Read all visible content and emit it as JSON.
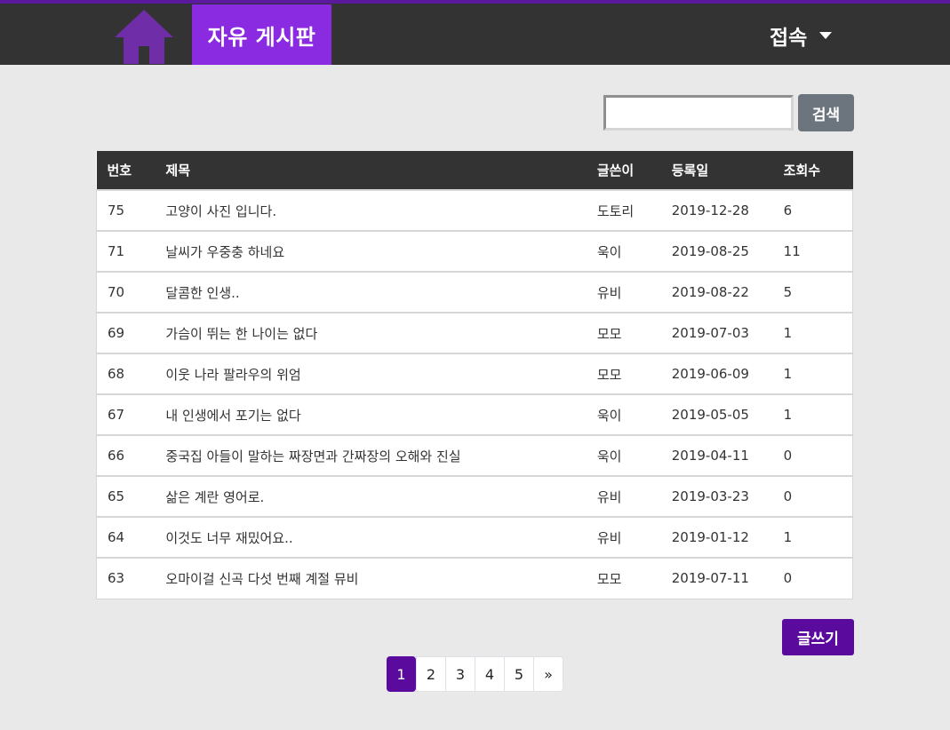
{
  "colors": {
    "header_bg": "#333333",
    "brand_bg": "#8a2be2",
    "home_icon": "#6f2da8",
    "accent_purple": "#5b0a9e",
    "search_button": "#6c757d",
    "page_bg": "#e9e9e9"
  },
  "header": {
    "home_icon": "house-icon",
    "brand": "자유 게시판",
    "connect_menu": "접속",
    "connect_icon": "caret-down-icon"
  },
  "search": {
    "value": "",
    "button_label": "검색"
  },
  "table": {
    "columns": [
      "번호",
      "제목",
      "글쓴이",
      "등록일",
      "조회수"
    ],
    "rows": [
      {
        "num": "75",
        "title": "고양이 사진 입니다.",
        "author": "도토리",
        "date": "2019-12-28",
        "views": "6"
      },
      {
        "num": "71",
        "title": "날씨가 우중충 하네요",
        "author": "욱이",
        "date": "2019-08-25",
        "views": "11"
      },
      {
        "num": "70",
        "title": "달콤한 인생..",
        "author": "유비",
        "date": "2019-08-22",
        "views": "5"
      },
      {
        "num": "69",
        "title": "가슴이 뛰는 한 나이는 없다",
        "author": "모모",
        "date": "2019-07-03",
        "views": "1"
      },
      {
        "num": "68",
        "title": "이웃 나라 팔라우의 위엄",
        "author": "모모",
        "date": "2019-06-09",
        "views": "1"
      },
      {
        "num": "67",
        "title": "내 인생에서 포기는 없다",
        "author": "욱이",
        "date": "2019-05-05",
        "views": "1"
      },
      {
        "num": "66",
        "title": "중국집 아들이 말하는 짜장면과 간짜장의 오해와 진실",
        "author": "욱이",
        "date": "2019-04-11",
        "views": "0"
      },
      {
        "num": "65",
        "title": "삶은 계란 영어로.",
        "author": "유비",
        "date": "2019-03-23",
        "views": "0"
      },
      {
        "num": "64",
        "title": "이것도 너무 재밌어요..",
        "author": "유비",
        "date": "2019-01-12",
        "views": "1"
      },
      {
        "num": "63",
        "title": "오마이걸 신곡 다섯 번째 계절 뮤비",
        "author": "모모",
        "date": "2019-07-11",
        "views": "0"
      }
    ]
  },
  "write_button": "글쓰기",
  "pagination": {
    "pages": [
      "1",
      "2",
      "3",
      "4",
      "5"
    ],
    "active": "1",
    "next": "»"
  }
}
